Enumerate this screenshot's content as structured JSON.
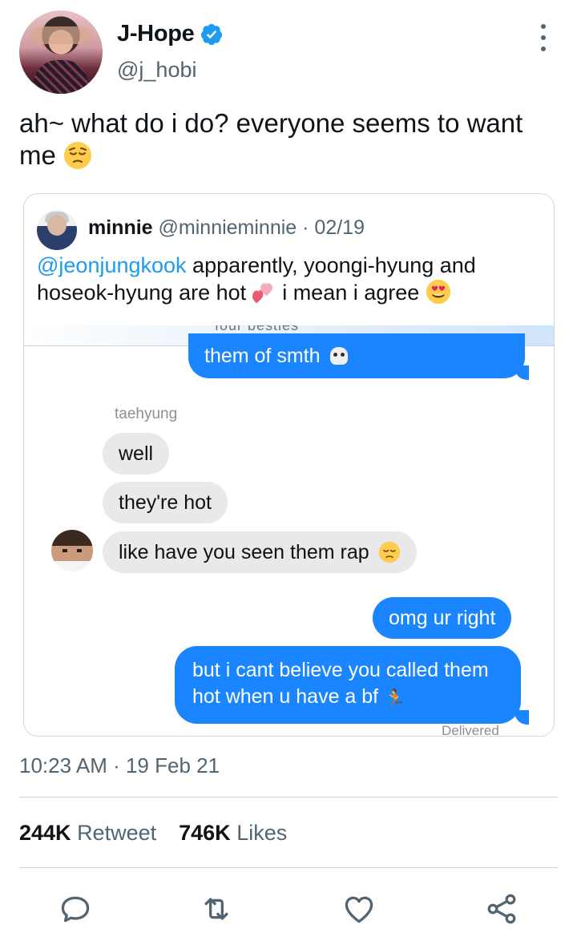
{
  "author": {
    "display_name": "J-Hope",
    "handle": "@j_hobi"
  },
  "tweet": {
    "text": "ah~ what do i do? everyone seems to want me",
    "emoji": "pensive-face"
  },
  "quote": {
    "name": "minnie",
    "handle_date": "@minnieminnie · 02/19",
    "mention": "@jeonjungkook",
    "text_part1": " apparently, yoongi-hyung and hoseok-hyung are hot ",
    "text_part2": " i mean i agree ",
    "emoji_1": "two-hearts",
    "emoji_2": "heart-eyes",
    "chat": {
      "cut_header": "four besties",
      "bubble_smth": "them of smth",
      "sender": "taehyung",
      "bubble_well": "well",
      "bubble_hot": "they're hot",
      "bubble_rap": "like have you seen them rap",
      "bubble_right": "omg ur right",
      "bubble_cant": "but i cant believe you called them hot when u have a bf",
      "delivered": "Delivered"
    }
  },
  "meta": {
    "timestamp": "10:23 AM · 19 Feb 21",
    "retweets_count": "244K",
    "retweets_label": "Retweet",
    "likes_count": "746K",
    "likes_label": "Likes"
  },
  "colors": {
    "verified": "#1d9bf0",
    "link": "#1d9bf0",
    "imessage_blue": "#1a85ff",
    "imessage_gray": "#e9e9eb",
    "icon_gray": "#536471"
  }
}
